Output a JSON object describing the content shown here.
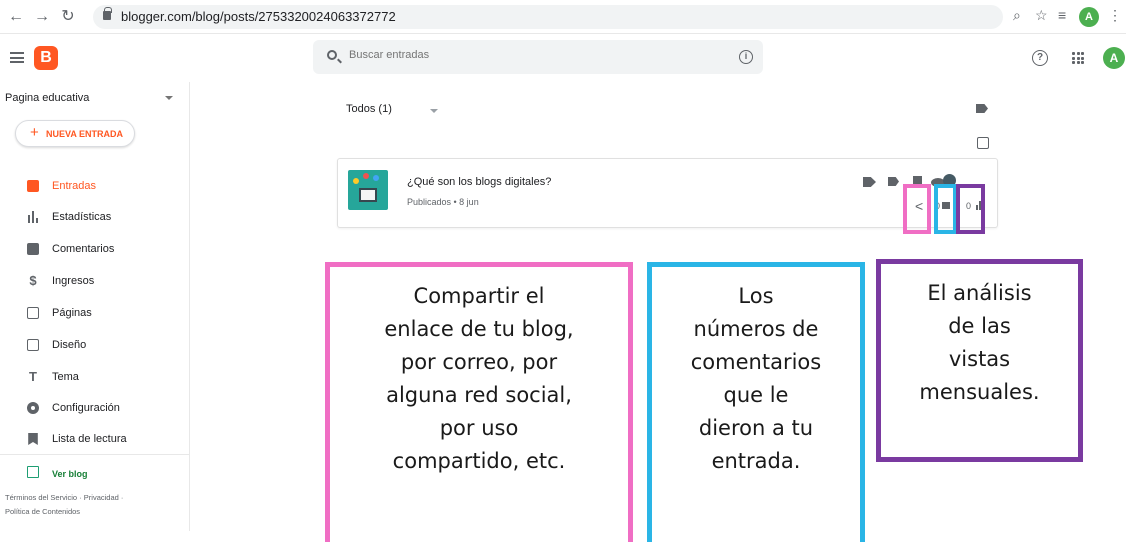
{
  "browser": {
    "url": "blogger.com/blog/posts/2753320024063372772",
    "profile_initial": "A"
  },
  "topbar": {
    "search_placeholder": "Buscar entradas",
    "avatar_initial": "A",
    "logo_letter": "B"
  },
  "sidebar": {
    "blog_name": "Pagina educativa",
    "new_entry_label": "NUEVA ENTRADA",
    "items": [
      {
        "label": "Entradas",
        "icon": "posts-icon",
        "active": true
      },
      {
        "label": "Estadísticas",
        "icon": "stats-icon",
        "active": false
      },
      {
        "label": "Comentarios",
        "icon": "comments-icon",
        "active": false
      },
      {
        "label": "Ingresos",
        "icon": "dollar-icon",
        "active": false
      },
      {
        "label": "Páginas",
        "icon": "pages-icon",
        "active": false
      },
      {
        "label": "Diseño",
        "icon": "layout-icon",
        "active": false
      },
      {
        "label": "Tema",
        "icon": "theme-icon",
        "active": false
      },
      {
        "label": "Configuración",
        "icon": "gear-icon",
        "active": false
      },
      {
        "label": "Lista de lectura",
        "icon": "bookmark-icon",
        "active": false
      }
    ],
    "view_blog_label": "Ver blog",
    "footer_line1": "Términos del Servicio · Privacidad ·",
    "footer_line2": "Política de Contenidos"
  },
  "main": {
    "filter_label": "Todos (1)",
    "post": {
      "title": "¿Qué son los blogs digitales?",
      "meta": "Publicados • 8 jun",
      "comments": "0",
      "views": "0"
    }
  },
  "annotations": {
    "share": [
      "Compartir el",
      "enlace de tu blog,",
      "por correo, por",
      "alguna red social,",
      "por uso",
      "compartido, etc."
    ],
    "comments": [
      "Los",
      "números de",
      "comentarios",
      "que le",
      "dieron a tu",
      "entrada."
    ],
    "views": [
      "El análisis",
      "de las",
      "vistas",
      "mensuales."
    ]
  },
  "colors": {
    "accent": "#ff5722",
    "highlight_pink": "#f06ec4",
    "highlight_blue": "#2ab5e6",
    "highlight_purple": "#7a3aa0"
  }
}
